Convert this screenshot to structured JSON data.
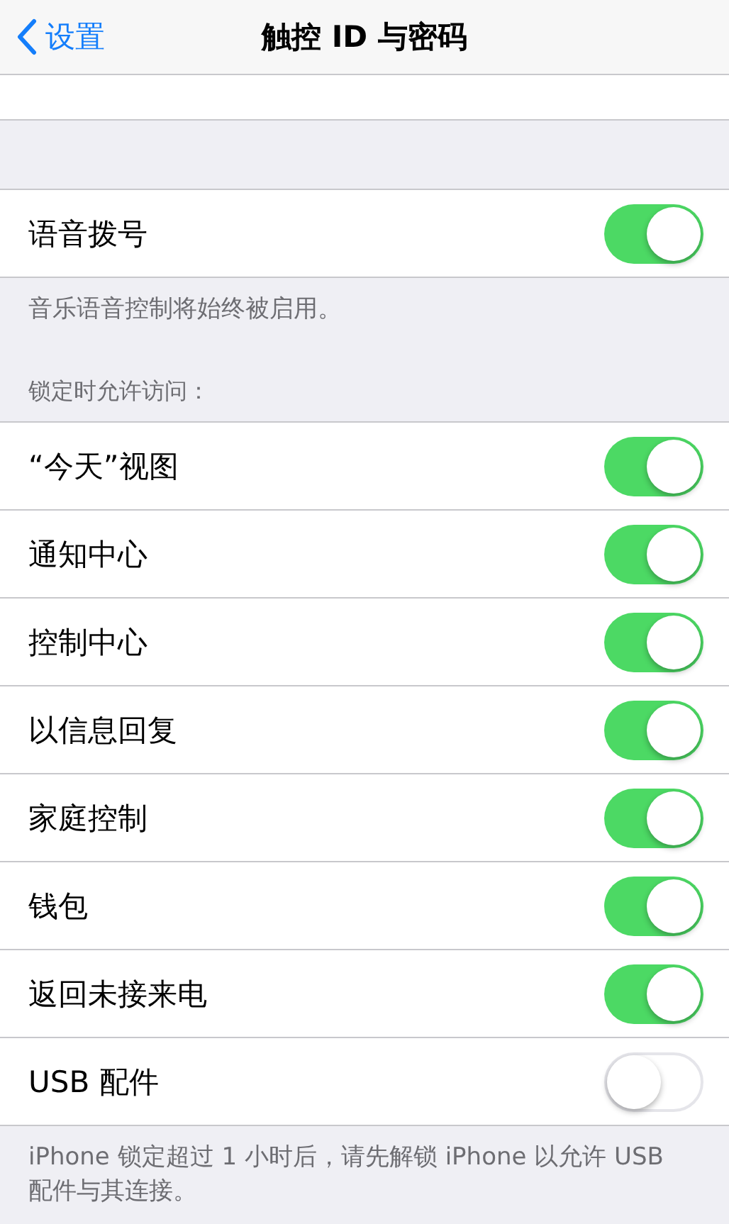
{
  "nav": {
    "back": "设置",
    "title": "触控 ID 与密码"
  },
  "voice_group": {
    "rows": [
      {
        "label": "语音拨号",
        "on": true
      }
    ],
    "footer": "音乐语音控制将始终被启用。"
  },
  "lock_group": {
    "header": "锁定时允许访问：",
    "rows": [
      {
        "label": "“今天”视图",
        "on": true
      },
      {
        "label": "通知中心",
        "on": true
      },
      {
        "label": "控制中心",
        "on": true
      },
      {
        "label": "以信息回复",
        "on": true
      },
      {
        "label": "家庭控制",
        "on": true
      },
      {
        "label": "钱包",
        "on": true
      },
      {
        "label": "返回未接来电",
        "on": true
      },
      {
        "label": "USB 配件",
        "on": false
      }
    ],
    "footer": "iPhone 锁定超过 1 小时后，请先解锁 iPhone 以允许 USB 配件与其连接。"
  }
}
